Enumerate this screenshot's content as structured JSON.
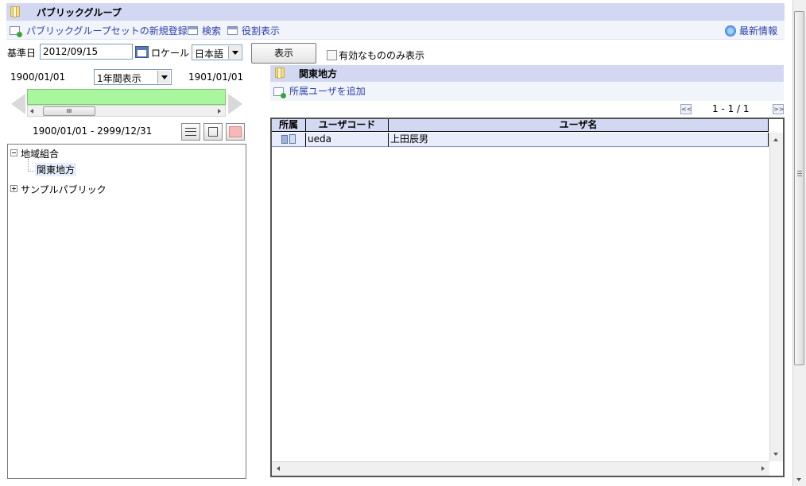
{
  "header": {
    "title": "パブリックグループ",
    "actions": {
      "new_set": "パブリックグループセットの新規登録",
      "search": "検索",
      "role_view": "役割表示",
      "latest": "最新情報"
    }
  },
  "filters": {
    "base_date_label": "基準日",
    "base_date_value": "2012/09/15",
    "locale_label": "ロケール",
    "locale_value": "日本語",
    "show_button": "表示",
    "valid_only_label": "有効なもののみ表示"
  },
  "timeline": {
    "start": "1900/01/01",
    "span_select": "1年間表示",
    "end": "1901/01/01",
    "range": "1900/01/01 - 2999/12/31",
    "scroll_grip": "III"
  },
  "tree": {
    "root": "地域組合",
    "child": "関東地方",
    "sibling": "サンプルパブリック"
  },
  "detail": {
    "title": "関東地方",
    "add_user": "所属ユーザを追加",
    "pager": "1 - 1 / 1",
    "first_symbol": "<<",
    "last_symbol": ">>",
    "columns": [
      "所属",
      "ユーザコード",
      "ユーザ名"
    ],
    "rows": [
      {
        "user_code": "ueda",
        "user_name": "上田辰男"
      }
    ]
  },
  "colors": {
    "header_bg": "#d3d8f2",
    "toolbar_bg": "#f2f4fc",
    "timeline_bar": "#aaf69e",
    "link": "#2a3fa8"
  }
}
